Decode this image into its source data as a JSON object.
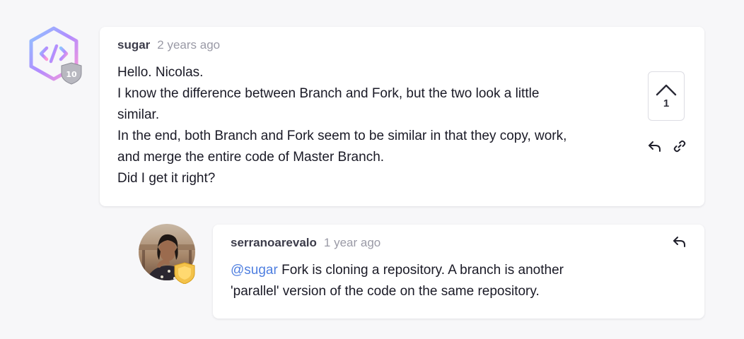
{
  "comment": {
    "author": "sugar",
    "time": "2 years ago",
    "badge_level": "10",
    "body_lines": [
      "Hello. Nicolas.",
      "I know the difference between Branch and Fork, but the two look a little",
      "similar.",
      "In the end, both Branch and Fork seem to be similar in that they copy, work,",
      "and merge the entire code of Master Branch.",
      "Did I get it right?"
    ],
    "upvotes": "1",
    "icons": [
      "chevron-up-icon",
      "reply-icon",
      "link-icon"
    ]
  },
  "reply": {
    "author": "serranoarevalo",
    "time": "1 year ago",
    "mention": "@sugar",
    "body_line_1_rest": " Fork is cloning a repository. A branch is another",
    "body_line_2": "'parallel' version of the code on the same repository.",
    "icons": [
      "reply-icon",
      "shield-badge-icon"
    ]
  },
  "colors": {
    "background": "#f7f7f9",
    "card": "#ffffff",
    "mention": "#4f7fe0",
    "muted": "#9a9aa6"
  }
}
